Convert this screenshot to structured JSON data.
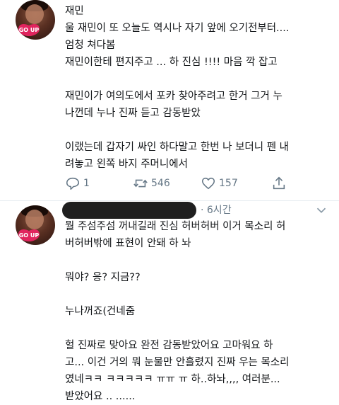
{
  "tweet1": {
    "name": "재민",
    "lines": [
      "울 재민이 또 오늘도 역시나 자기 앞에 오기전부터....",
      "엄청 쳐다봄",
      "재민이한테 편지주고 ... 하 진심 !!!! 마음 깍 잡고",
      "",
      "재민이가 여의도에서 포카 찾아주려고 한거 그거 누",
      "나껀데 누나 진짜 듣고 감동받았",
      "",
      "이랬는데 갑자기 싸인 하다말고 한번 나 보더니 펜 내",
      "려놓고 왼쪽 바지 주머니에서"
    ],
    "actions": {
      "reply": "1",
      "retweet": "546",
      "like": "157"
    }
  },
  "avatar_badge": "GO UP",
  "tweet2": {
    "time": "· 6시간",
    "lines": [
      "뭘 주섬주섬 꺼내길래 진심 허버허버 이거 목소리 허",
      "버허버밖에 표현이 안돼 하 놔",
      "",
      "뭐야? 응? 지금??",
      "",
      "누나꺼죠(건네줌",
      "",
      "헐 진짜로 맞아요 완전 감동받았어요 고마워요 하",
      "고... 이건 거의 뭐 눈물만 안흘렸지 진짜 우는 목소리",
      "였네ㅋㅋ ㅋㅋㅋㅋㅋ ㅠㅠ ㅠ 하..하놔,,,, 여러분...",
      "받았어요 .. ......"
    ]
  },
  "colors": {
    "text": "#14171a",
    "meta": "#657786",
    "divider": "#e6ecf0",
    "badge": "#e0245e"
  }
}
